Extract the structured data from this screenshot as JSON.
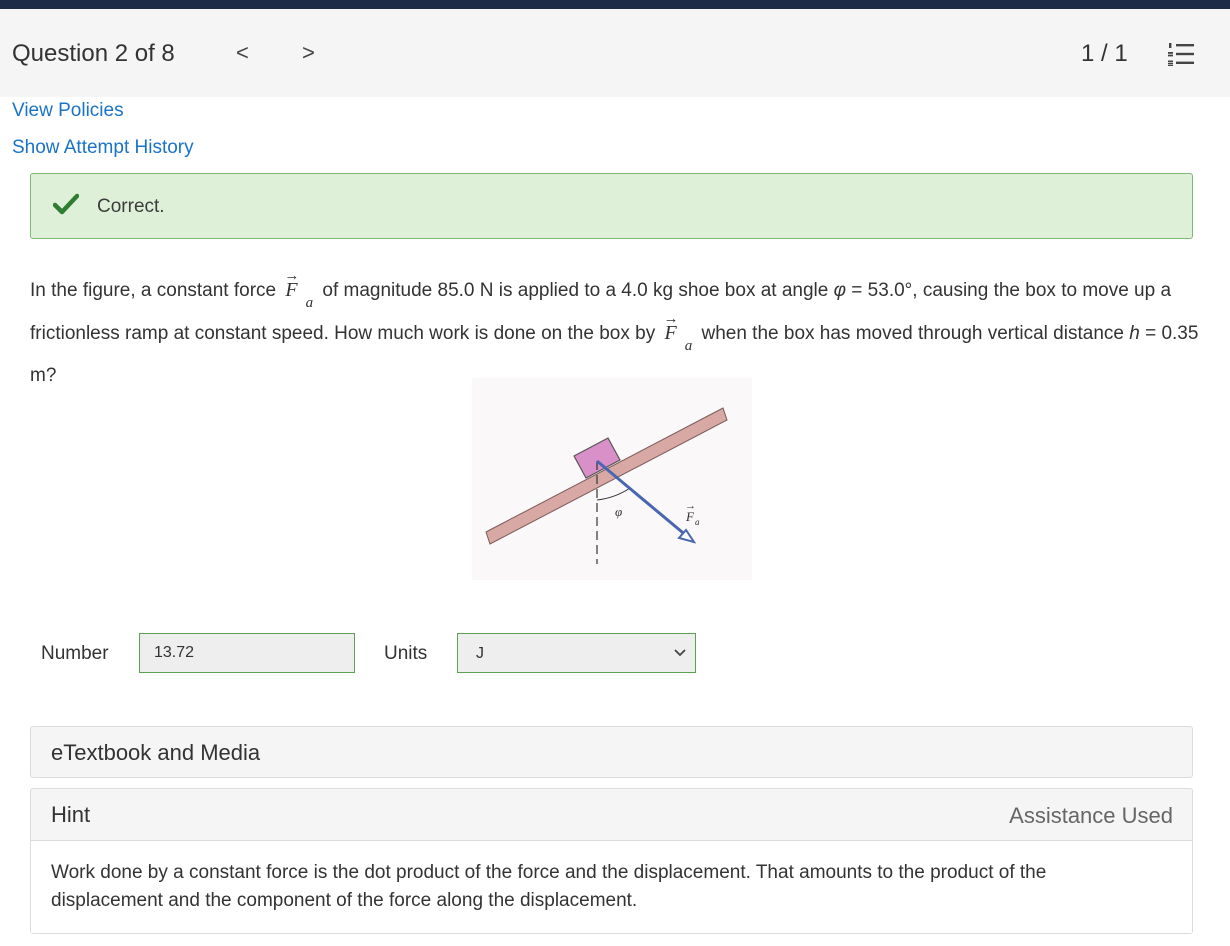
{
  "header": {
    "question_label": "Question 2 of 8",
    "prev_label": "<",
    "next_label": ">",
    "counter": "1 / 1",
    "list_icon": "list-numbered-icon"
  },
  "links": {
    "view_policies": "View Policies",
    "attempt_history": "Show Attempt History"
  },
  "feedback": {
    "icon": "checkmark-icon",
    "text": "Correct.",
    "color": "#dff0d8"
  },
  "question": {
    "part1": "In the figure, a constant force ",
    "vec_symbol": "F",
    "vec_arrow": "→",
    "vec_sub": "a",
    "part2": " of magnitude 85.0 N is applied to a 4.0 kg shoe box at angle ",
    "phi": "φ",
    "part3": " = 53.0°, causing the box to move up a frictionless ramp at constant speed. How much work is done on the box by ",
    "part4": " when the box has moved through vertical distance ",
    "h": "h",
    "part5": " = 0.35 m?"
  },
  "figure": {
    "phi_label": "φ",
    "force_label": "F",
    "force_sub": "a",
    "force_arrow": "→"
  },
  "answer": {
    "number_label": "Number",
    "number_value": "13.72",
    "units_label": "Units",
    "units_value": "J"
  },
  "etextbook": {
    "title": "eTextbook and Media"
  },
  "hint": {
    "title": "Hint",
    "status": "Assistance Used",
    "text": "Work done by a constant force is the dot product of the force and the displacement. That amounts to the product of the displacement and the component of the force along the displacement."
  }
}
